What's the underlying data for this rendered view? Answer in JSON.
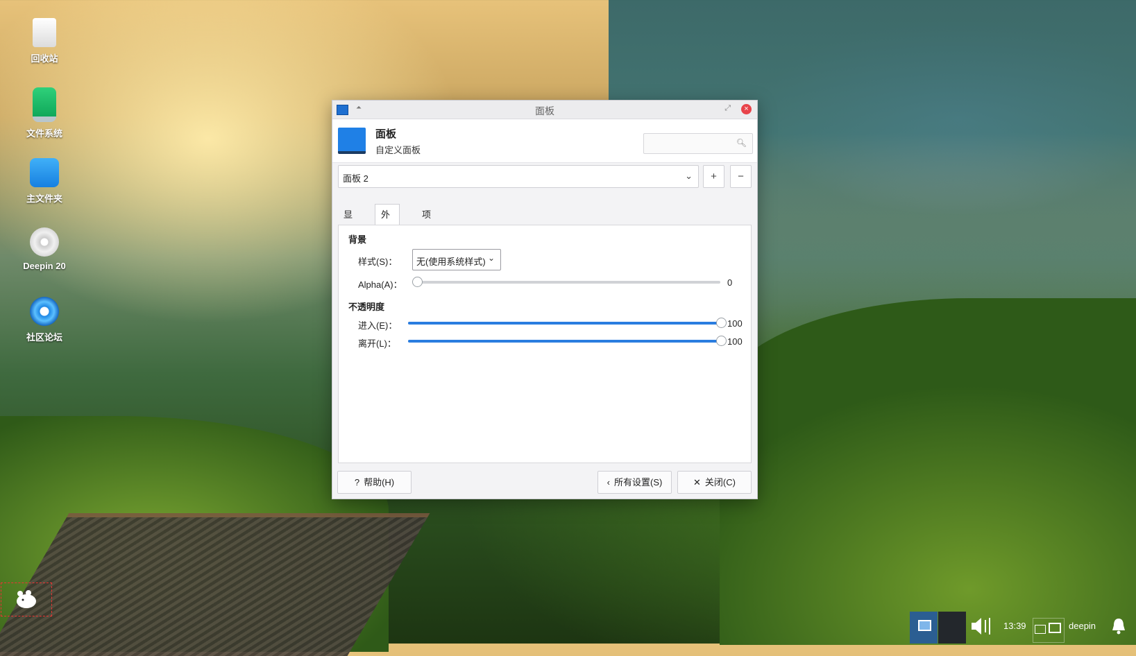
{
  "desktop": {
    "icons": [
      {
        "label": "回收站",
        "icon": "trash-icon"
      },
      {
        "label": "文件系统",
        "icon": "drive-icon"
      },
      {
        "label": "主文件夹",
        "icon": "home-folder-icon"
      },
      {
        "label": "Deepin 20",
        "icon": "disc-icon"
      },
      {
        "label": "社区论坛",
        "icon": "deepin-logo-icon"
      }
    ]
  },
  "window": {
    "title": "面板",
    "header": {
      "title": "面板",
      "subtitle": "自定义面板",
      "search_placeholder": ""
    },
    "panel_select": {
      "value": "面板 2"
    },
    "add_label": "+",
    "remove_label": "−",
    "tabs": [
      {
        "label": "显示(I)",
        "active": false
      },
      {
        "label": "外观(N)",
        "active": true
      },
      {
        "label": "项目(M)",
        "active": false
      }
    ],
    "background_section": {
      "title": "背景",
      "style_label": "样式(S)：",
      "style_value": "无(使用系统样式)",
      "alpha_label": "Alpha(A)：",
      "alpha_value": "0",
      "alpha_fraction": 0.0
    },
    "opacity_section": {
      "title": "不透明度",
      "enter_label": "进入(E)：",
      "enter_value": "100",
      "enter_fraction": 1.0,
      "leave_label": "离开(L)：",
      "leave_value": "100",
      "leave_fraction": 1.0
    },
    "buttons": {
      "help": "帮助(H)",
      "all_settings": "所有设置(S)",
      "close": "关闭(C)"
    }
  },
  "taskbar": {
    "time": "13:39",
    "user": "deepin"
  },
  "colors": {
    "accent": "#2a7de0",
    "close": "#e8434a"
  }
}
